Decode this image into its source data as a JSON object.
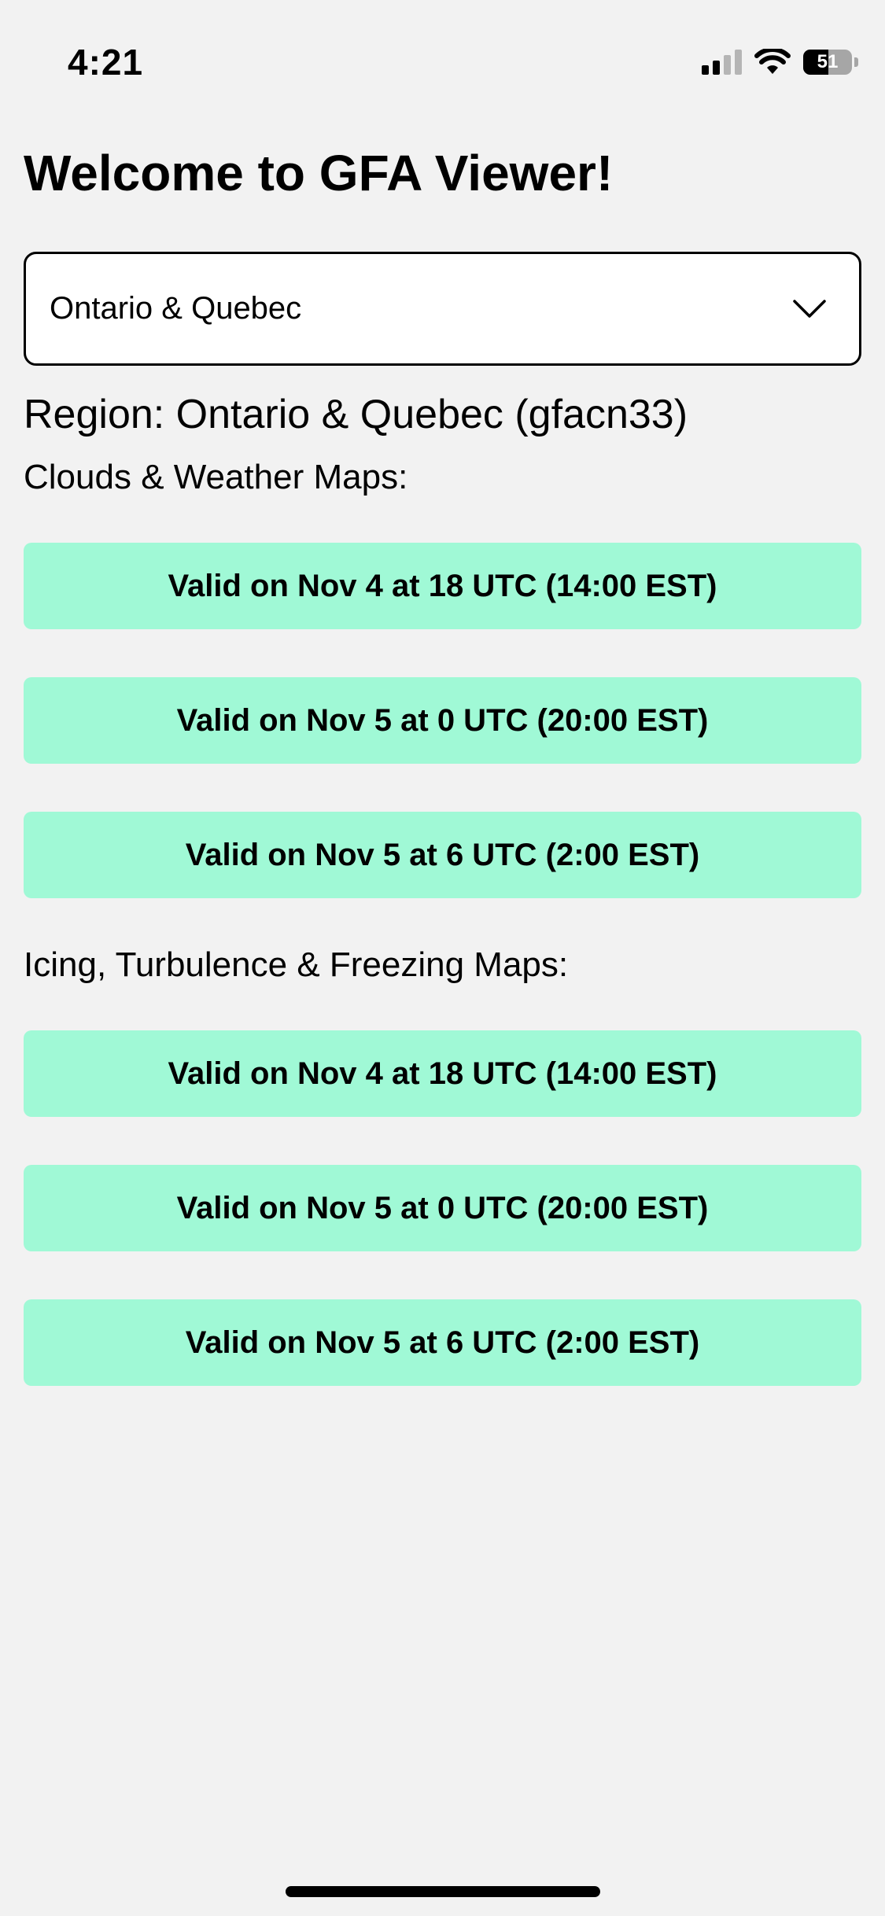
{
  "status_bar": {
    "time": "4:21",
    "battery_level": "51"
  },
  "page_title": "Welcome to GFA Viewer!",
  "region_select": {
    "selected": "Ontario & Quebec"
  },
  "region_heading": "Region: Ontario & Quebec (gfacn33)",
  "sections": [
    {
      "label": "Clouds & Weather Maps:",
      "buttons": [
        "Valid on Nov 4 at 18 UTC (14:00 EST)",
        "Valid on Nov 5 at 0 UTC (20:00 EST)",
        "Valid on Nov 5 at 6 UTC (2:00 EST)"
      ]
    },
    {
      "label": "Icing, Turbulence & Freezing Maps:",
      "buttons": [
        "Valid on Nov 4 at 18 UTC (14:00 EST)",
        "Valid on Nov 5 at 0 UTC (20:00 EST)",
        "Valid on Nov 5 at 6 UTC (2:00 EST)"
      ]
    }
  ],
  "colors": {
    "button_bg": "#a0f9d6",
    "page_bg": "#f2f2f2"
  }
}
